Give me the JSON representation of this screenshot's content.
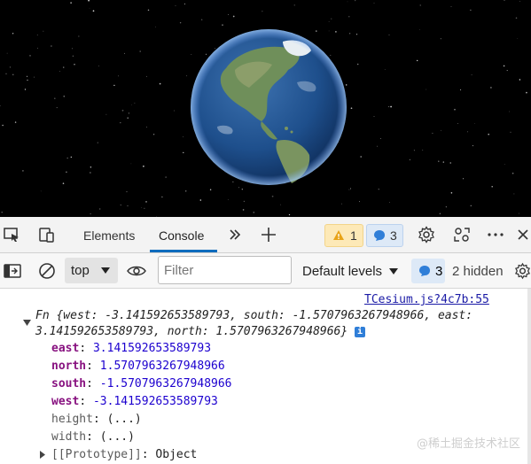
{
  "devtools": {
    "tabs": [
      {
        "label": "Elements"
      },
      {
        "label": "Console"
      }
    ],
    "warnings_count": "1",
    "messages_count": "3",
    "toolbar": {
      "context": "top",
      "filter_placeholder": "Filter",
      "levels_label": "Default levels",
      "hidden_badge_count": "3",
      "hidden_label": "2 hidden"
    }
  },
  "console": {
    "source_link": "TCesium.js?4c7b:55",
    "summary_line1": "Fn {west: -3.141592653589793, south: -1.5707963267948966, east:",
    "summary_line2": "3.141592653589793, north: 1.5707963267948966}",
    "properties": [
      {
        "key": "east",
        "value": "3.141592653589793"
      },
      {
        "key": "north",
        "value": "1.5707963267948966"
      },
      {
        "key": "south",
        "value": "-1.5707963267948966"
      },
      {
        "key": "west",
        "value": "-3.141592653589793"
      },
      {
        "key": "height",
        "value": "(...)"
      },
      {
        "key": "width",
        "value": "(...)"
      },
      {
        "key": "[[Prototype]]",
        "value": "Object"
      }
    ]
  },
  "watermark": "@稀土掘金技术社区",
  "colors": {
    "accent": "#0f6cbd",
    "property_key": "#881280",
    "number": "#1c00cf"
  }
}
